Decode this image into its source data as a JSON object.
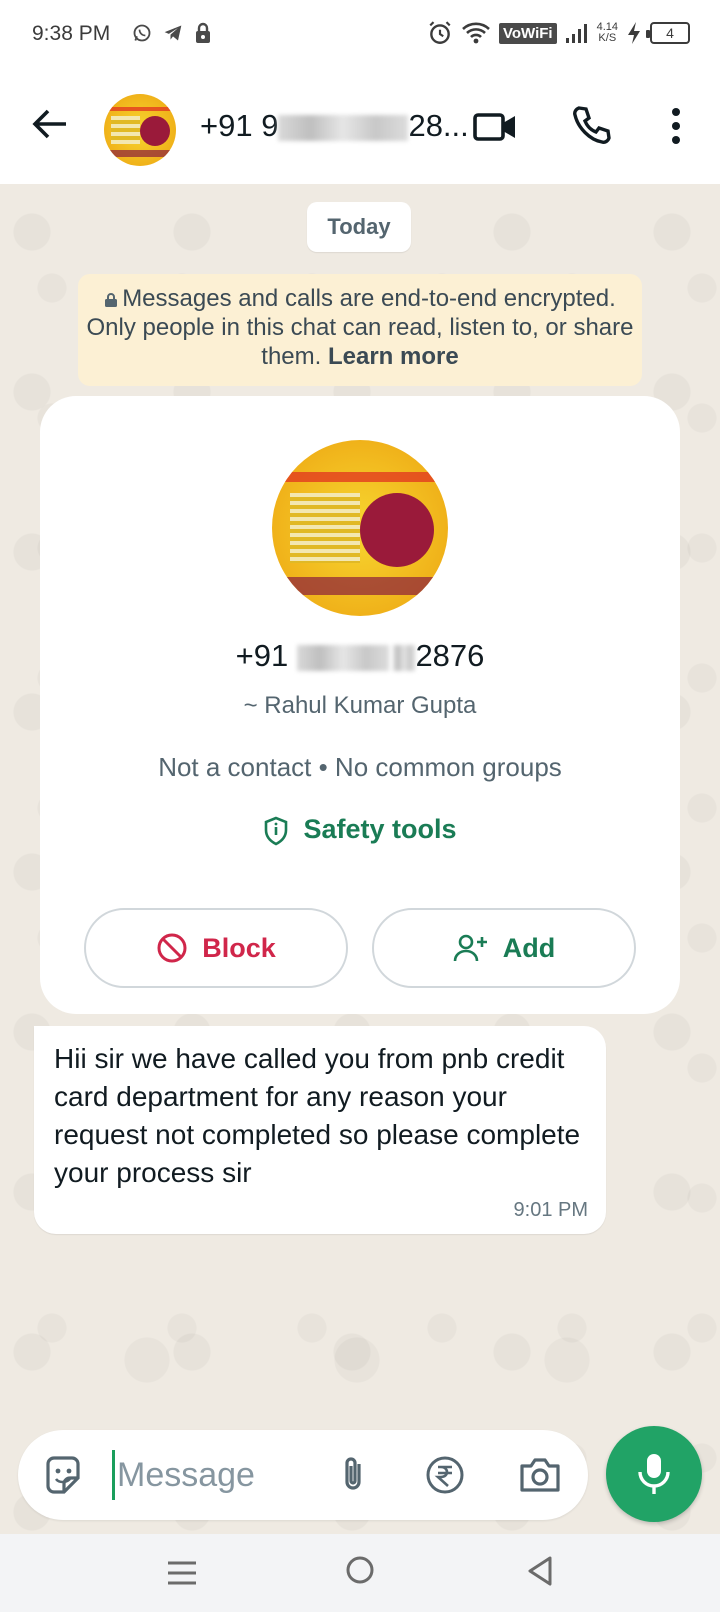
{
  "status_bar": {
    "time": "9:38 PM",
    "network_type": "VoWiFi",
    "net_speed_value": "4.14",
    "net_speed_unit": "K/S",
    "battery_level": "4"
  },
  "header": {
    "contact_prefix": "+91 9",
    "contact_suffix": "28..."
  },
  "chat": {
    "date_chip": "Today",
    "encryption_notice": "Messages and calls are end-to-end encrypted. Only people in this chat can read, listen to, or share them.",
    "learn_more": "Learn more"
  },
  "contact_card": {
    "number_prefix": "+91",
    "number_suffix": "2876",
    "display_name": "~ Rahul Kumar Gupta",
    "meta": "Not a contact • No common groups",
    "safety_tools": "Safety tools",
    "block_label": "Block",
    "add_label": "Add"
  },
  "messages": [
    {
      "text": "Hii sir we have called you from pnb credit card department for any reason your request not completed so please complete your process sir",
      "time": "9:01 PM"
    }
  ],
  "composer": {
    "placeholder": "Message"
  },
  "colors": {
    "accent_green": "#1a7c55",
    "mic_green": "#21a366",
    "block_red": "#d0264a",
    "chat_bg": "#efeae2",
    "notice_bg": "#fcf0d4"
  },
  "icons": {
    "status_left": [
      "whatsapp-icon",
      "telegram-icon",
      "lock-icon"
    ],
    "status_right": [
      "alarm-icon",
      "wifi-icon",
      "signal-icon",
      "charging-icon",
      "battery-icon"
    ],
    "header": [
      "back-arrow-icon",
      "video-call-icon",
      "phone-icon",
      "more-vert-icon"
    ],
    "composer": [
      "sticker-icon",
      "attach-icon",
      "rupee-icon",
      "camera-icon",
      "mic-icon"
    ],
    "nav": [
      "menu-icon",
      "home-icon",
      "back-triangle-icon"
    ]
  }
}
